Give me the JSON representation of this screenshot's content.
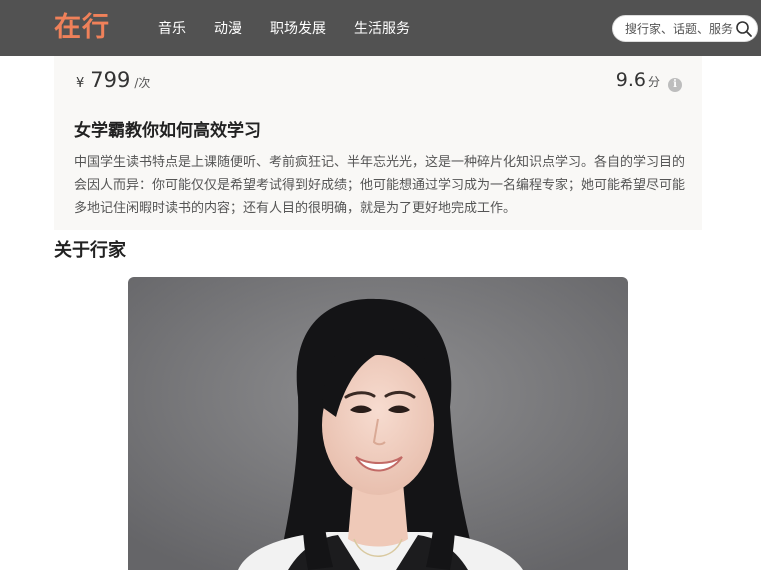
{
  "header": {
    "logo": "在行",
    "nav": [
      "音乐",
      "动漫",
      "职场发展",
      "生活服务"
    ],
    "search_placeholder": "搜行家、话题、服务"
  },
  "course": {
    "currency": "¥",
    "price": "799",
    "unit": "/次",
    "score": "9.6",
    "score_unit": "分",
    "info_icon": "info-icon",
    "title": "女学霸教你如何高效学习",
    "description": "中国学生读书特点是上课随便听、考前疯狂记、半年忘光光，这是一种碎片化知识点学习。各自的学习目的会因人而异：你可能仅仅是希望考试得到好成绩；他可能想通过学习成为一名编程专家；她可能希望尽可能多地记住闲暇时读书的内容；还有人目的很明确，就是为了更好地完成工作。"
  },
  "about": {
    "title": "关于行家"
  },
  "colors": {
    "topbar": "#525252",
    "logo": "#f0815a",
    "card_bg": "#f9f8f6"
  }
}
